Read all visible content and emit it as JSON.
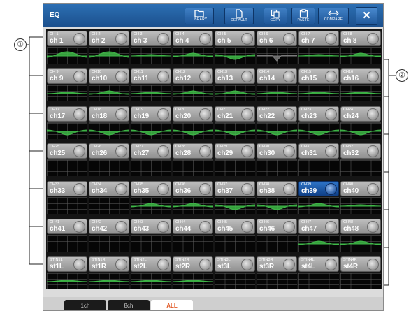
{
  "window": {
    "title": "EQ"
  },
  "toolbar": {
    "library": "LIBRARY",
    "default": "DEFAULT",
    "copy": "COPY",
    "paste": "PASTE",
    "compare": "COMPARE",
    "close": "✕"
  },
  "channels": [
    {
      "id": "CH 1",
      "name": "ch 1",
      "curve": "bump",
      "selected": false
    },
    {
      "id": "CH 2",
      "name": "ch 2",
      "curve": "bump",
      "selected": false
    },
    {
      "id": "CH 3",
      "name": "ch 3",
      "curve": "flat",
      "selected": false
    },
    {
      "id": "CH 4",
      "name": "ch 4",
      "curve": "hump",
      "selected": false
    },
    {
      "id": "CH 5",
      "name": "ch 5",
      "curve": "dip",
      "selected": false
    },
    {
      "id": "CH 6",
      "name": "ch 6",
      "curve": "notch",
      "selected": false
    },
    {
      "id": "CH 7",
      "name": "ch 7",
      "curve": "flat",
      "selected": false
    },
    {
      "id": "CH 8",
      "name": "ch 8",
      "curve": "hump",
      "selected": false
    },
    {
      "id": "CH 9",
      "name": "ch 9",
      "curve": "flat",
      "selected": false
    },
    {
      "id": "CH10",
      "name": "ch10",
      "curve": "hump",
      "selected": false
    },
    {
      "id": "CH11",
      "name": "ch11",
      "curve": "flat",
      "selected": false
    },
    {
      "id": "CH12",
      "name": "ch12",
      "curve": "hump",
      "selected": false
    },
    {
      "id": "CH13",
      "name": "ch13",
      "curve": "hump",
      "selected": false
    },
    {
      "id": "CH14",
      "name": "ch14",
      "curve": "flat",
      "selected": false
    },
    {
      "id": "CH15",
      "name": "ch15",
      "curve": "flat",
      "selected": false
    },
    {
      "id": "CH16",
      "name": "ch16",
      "curve": "flat",
      "selected": false
    },
    {
      "id": "CH17",
      "name": "ch17",
      "curve": "dip",
      "selected": false
    },
    {
      "id": "CH18",
      "name": "ch18",
      "curve": "dip",
      "selected": false
    },
    {
      "id": "CH19",
      "name": "ch19",
      "curve": "dip",
      "selected": false
    },
    {
      "id": "CH20",
      "name": "ch20",
      "curve": "dip",
      "selected": false
    },
    {
      "id": "CH21",
      "name": "ch21",
      "curve": "dip",
      "selected": false
    },
    {
      "id": "CH22",
      "name": "ch22",
      "curve": "dip",
      "selected": false
    },
    {
      "id": "CH23",
      "name": "ch23",
      "curve": "dip",
      "selected": false
    },
    {
      "id": "CH24",
      "name": "ch24",
      "curve": "dip",
      "selected": false
    },
    {
      "id": "CH25",
      "name": "ch25",
      "curve": "none",
      "selected": false
    },
    {
      "id": "CH26",
      "name": "ch26",
      "curve": "none",
      "selected": false
    },
    {
      "id": "CH27",
      "name": "ch27",
      "curve": "none",
      "selected": false
    },
    {
      "id": "CH28",
      "name": "ch28",
      "curve": "none",
      "selected": false
    },
    {
      "id": "CH29",
      "name": "ch29",
      "curve": "none",
      "selected": false
    },
    {
      "id": "CH30",
      "name": "ch30",
      "curve": "none",
      "selected": false
    },
    {
      "id": "CH31",
      "name": "ch31",
      "curve": "none",
      "selected": false
    },
    {
      "id": "CH32",
      "name": "ch32",
      "curve": "none",
      "selected": false
    },
    {
      "id": "CH33",
      "name": "ch33",
      "curve": "none",
      "selected": false
    },
    {
      "id": "CH34",
      "name": "ch34",
      "curve": "none",
      "selected": false
    },
    {
      "id": "CH35",
      "name": "ch35",
      "curve": "hump",
      "selected": false
    },
    {
      "id": "CH36",
      "name": "ch36",
      "curve": "hump",
      "selected": false
    },
    {
      "id": "CH37",
      "name": "ch37",
      "curve": "dip",
      "selected": false
    },
    {
      "id": "CH38",
      "name": "ch38",
      "curve": "dip",
      "selected": false
    },
    {
      "id": "CH39",
      "name": "ch39",
      "curve": "hump",
      "selected": true
    },
    {
      "id": "CH40",
      "name": "ch40",
      "curve": "flat",
      "selected": false
    },
    {
      "id": "CH41",
      "name": "ch41",
      "curve": "none",
      "selected": false
    },
    {
      "id": "CH42",
      "name": "ch42",
      "curve": "none",
      "selected": false
    },
    {
      "id": "CH43",
      "name": "ch43",
      "curve": "none",
      "selected": false
    },
    {
      "id": "CH44",
      "name": "ch44",
      "curve": "none",
      "selected": false
    },
    {
      "id": "CH45",
      "name": "ch45",
      "curve": "none",
      "selected": false
    },
    {
      "id": "CH46",
      "name": "ch46",
      "curve": "none",
      "selected": false
    },
    {
      "id": "CH47",
      "name": "ch47",
      "curve": "hump",
      "selected": false
    },
    {
      "id": "CH48",
      "name": "ch48",
      "curve": "hump",
      "selected": false
    },
    {
      "id": "STIN1L",
      "name": "st1L",
      "curve": "flat",
      "selected": false
    },
    {
      "id": "STIN1R",
      "name": "st1R",
      "curve": "flat",
      "selected": false
    },
    {
      "id": "STIN2L",
      "name": "st2L",
      "curve": "flat",
      "selected": false
    },
    {
      "id": "STIN2R",
      "name": "st2R",
      "curve": "flat",
      "selected": false
    },
    {
      "id": "STIN3L",
      "name": "st3L",
      "curve": "none",
      "selected": false
    },
    {
      "id": "STIN3R",
      "name": "st3R",
      "curve": "none",
      "selected": false
    },
    {
      "id": "STIN4L",
      "name": "st4L",
      "curve": "none",
      "selected": false
    },
    {
      "id": "STIN4R",
      "name": "st4R",
      "curve": "none",
      "selected": false
    }
  ],
  "tabs": [
    {
      "label": "1ch",
      "active": false
    },
    {
      "label": "8ch",
      "active": false
    },
    {
      "label": "ALL",
      "active": true
    }
  ],
  "callouts": {
    "left": "①",
    "right": "②"
  },
  "colors": {
    "eq_curve": "#3fb848",
    "eq_dip_notch": "#7a7a7a",
    "selected_channel": "#1f5ab0"
  }
}
